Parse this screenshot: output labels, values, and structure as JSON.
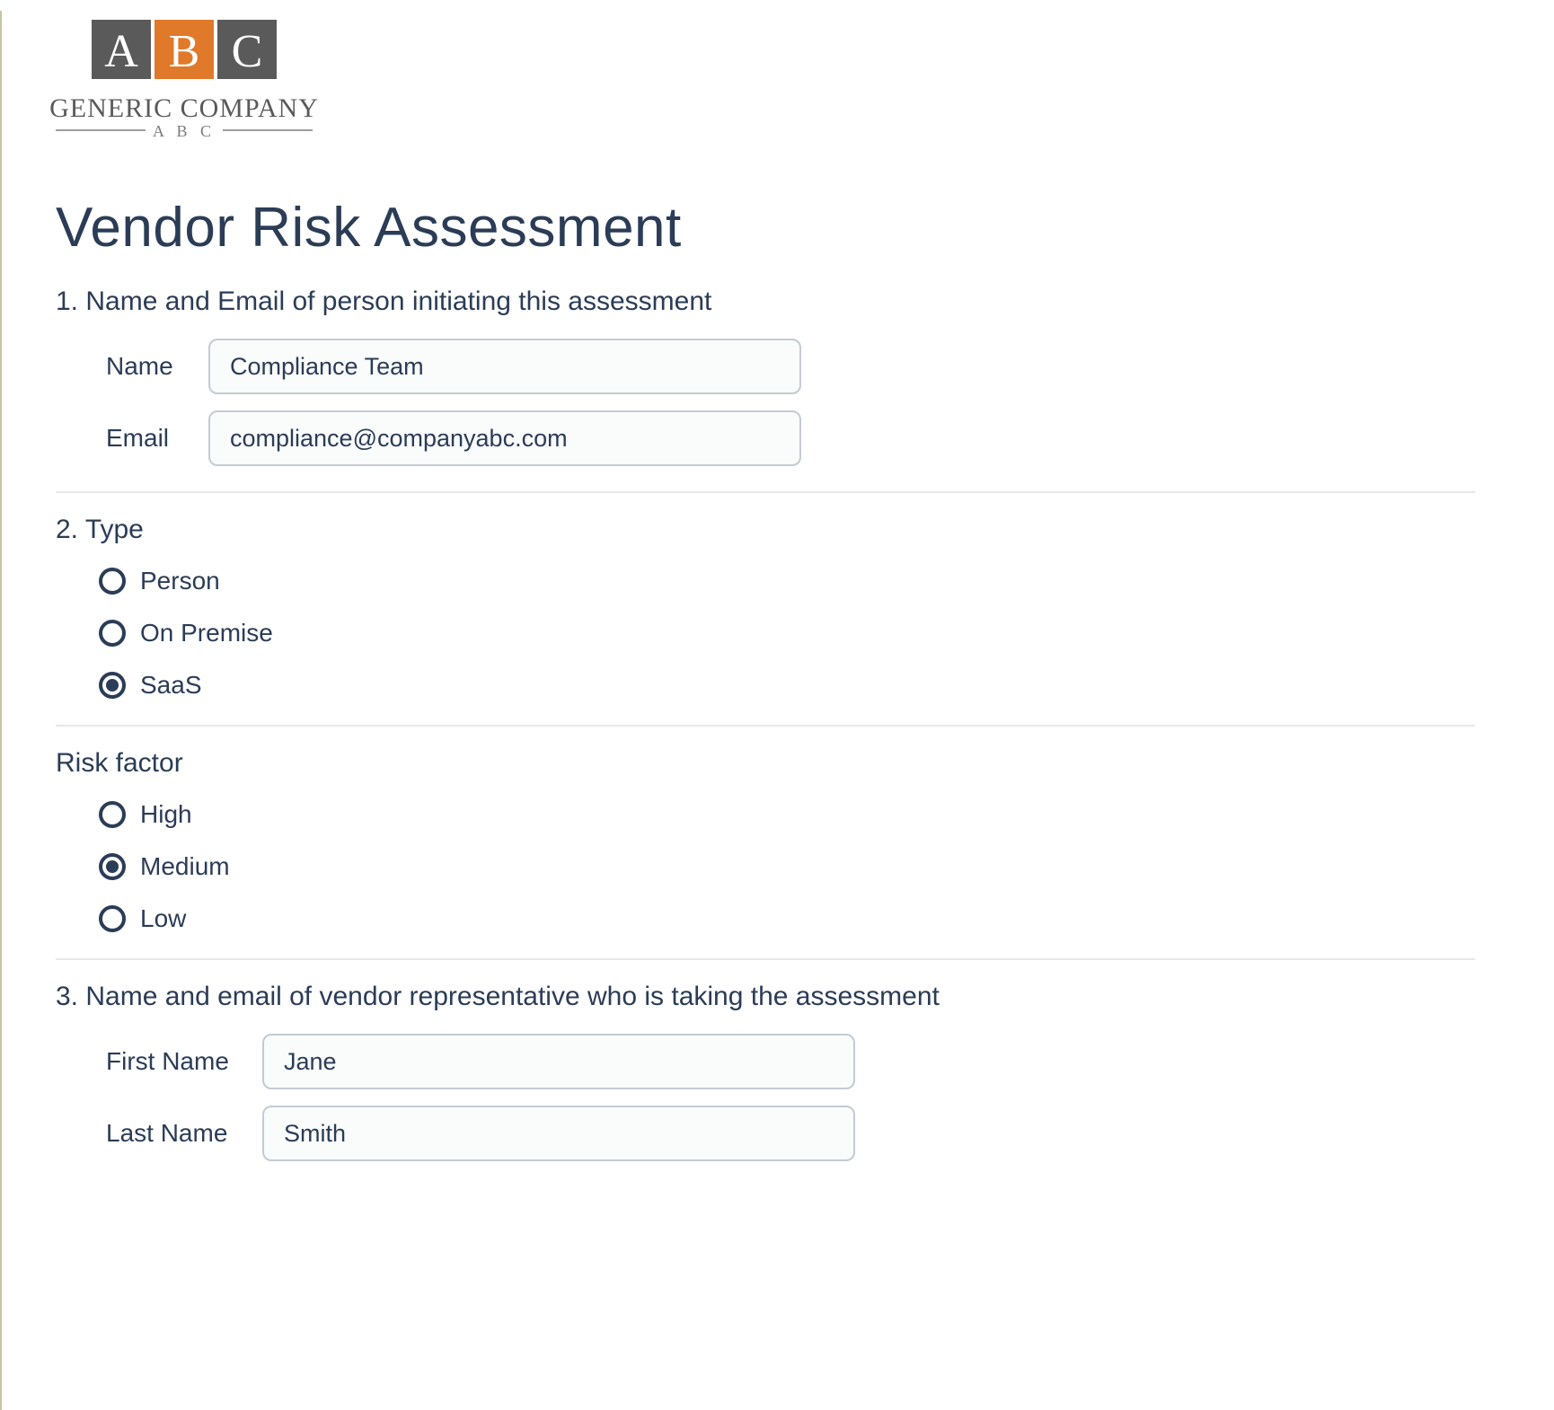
{
  "logo": {
    "letters": {
      "a": "A",
      "b": "B",
      "c": "C"
    },
    "company": "GENERIC COMPANY",
    "sub": "A B C"
  },
  "title": "Vendor Risk Assessment",
  "q1": {
    "label": "1. Name and Email of person initiating this assessment",
    "name_label": "Name",
    "name_value": "Compliance Team",
    "email_label": "Email",
    "email_value": "compliance@companyabc.com"
  },
  "q2": {
    "label": "2. Type",
    "options": [
      {
        "label": "Person",
        "selected": false
      },
      {
        "label": "On Premise",
        "selected": false
      },
      {
        "label": "SaaS",
        "selected": true
      }
    ]
  },
  "risk": {
    "label": "Risk factor",
    "options": [
      {
        "label": "High",
        "selected": false
      },
      {
        "label": "Medium",
        "selected": true
      },
      {
        "label": "Low",
        "selected": false
      }
    ]
  },
  "q3": {
    "label": "3. Name and email of vendor representative who is taking the assessment",
    "first_name_label": "First Name",
    "first_name_value": "Jane",
    "last_name_label": "Last Name",
    "last_name_value": "Smith"
  }
}
